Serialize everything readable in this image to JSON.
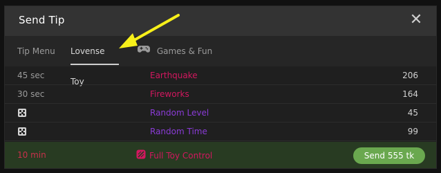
{
  "window": {
    "title": "Send Tip",
    "close_icon": "close-icon"
  },
  "tabs": [
    {
      "label": "Tip Menu",
      "active": false
    },
    {
      "label": "Lovense Toy",
      "active": true
    },
    {
      "label": "Games & Fun",
      "active": false,
      "icon": "gamepad-icon"
    }
  ],
  "rows": [
    {
      "duration": "45 sec",
      "name": "Earthquake",
      "tokens": "206",
      "name_color": "#d3175f"
    },
    {
      "duration": "30 sec",
      "name": "Fireworks",
      "tokens": "164",
      "name_color": "#d3175f"
    },
    {
      "icon": "dice-icon",
      "name": "Random Level",
      "tokens": "45",
      "name_color": "#8a3bd6"
    },
    {
      "icon": "dice-icon",
      "name": "Random Time",
      "tokens": "99",
      "name_color": "#8a3bd6"
    }
  ],
  "footer": {
    "duration": "10 min",
    "control_label": "Full Toy Control",
    "control_icon": "toy-control-icon",
    "send_label": "Send 555 tk"
  },
  "colors": {
    "accent_magenta": "#d3175f",
    "accent_purple": "#8a3bd6",
    "send_green": "#6aa84f",
    "annotation_yellow": "#f7f01a"
  }
}
